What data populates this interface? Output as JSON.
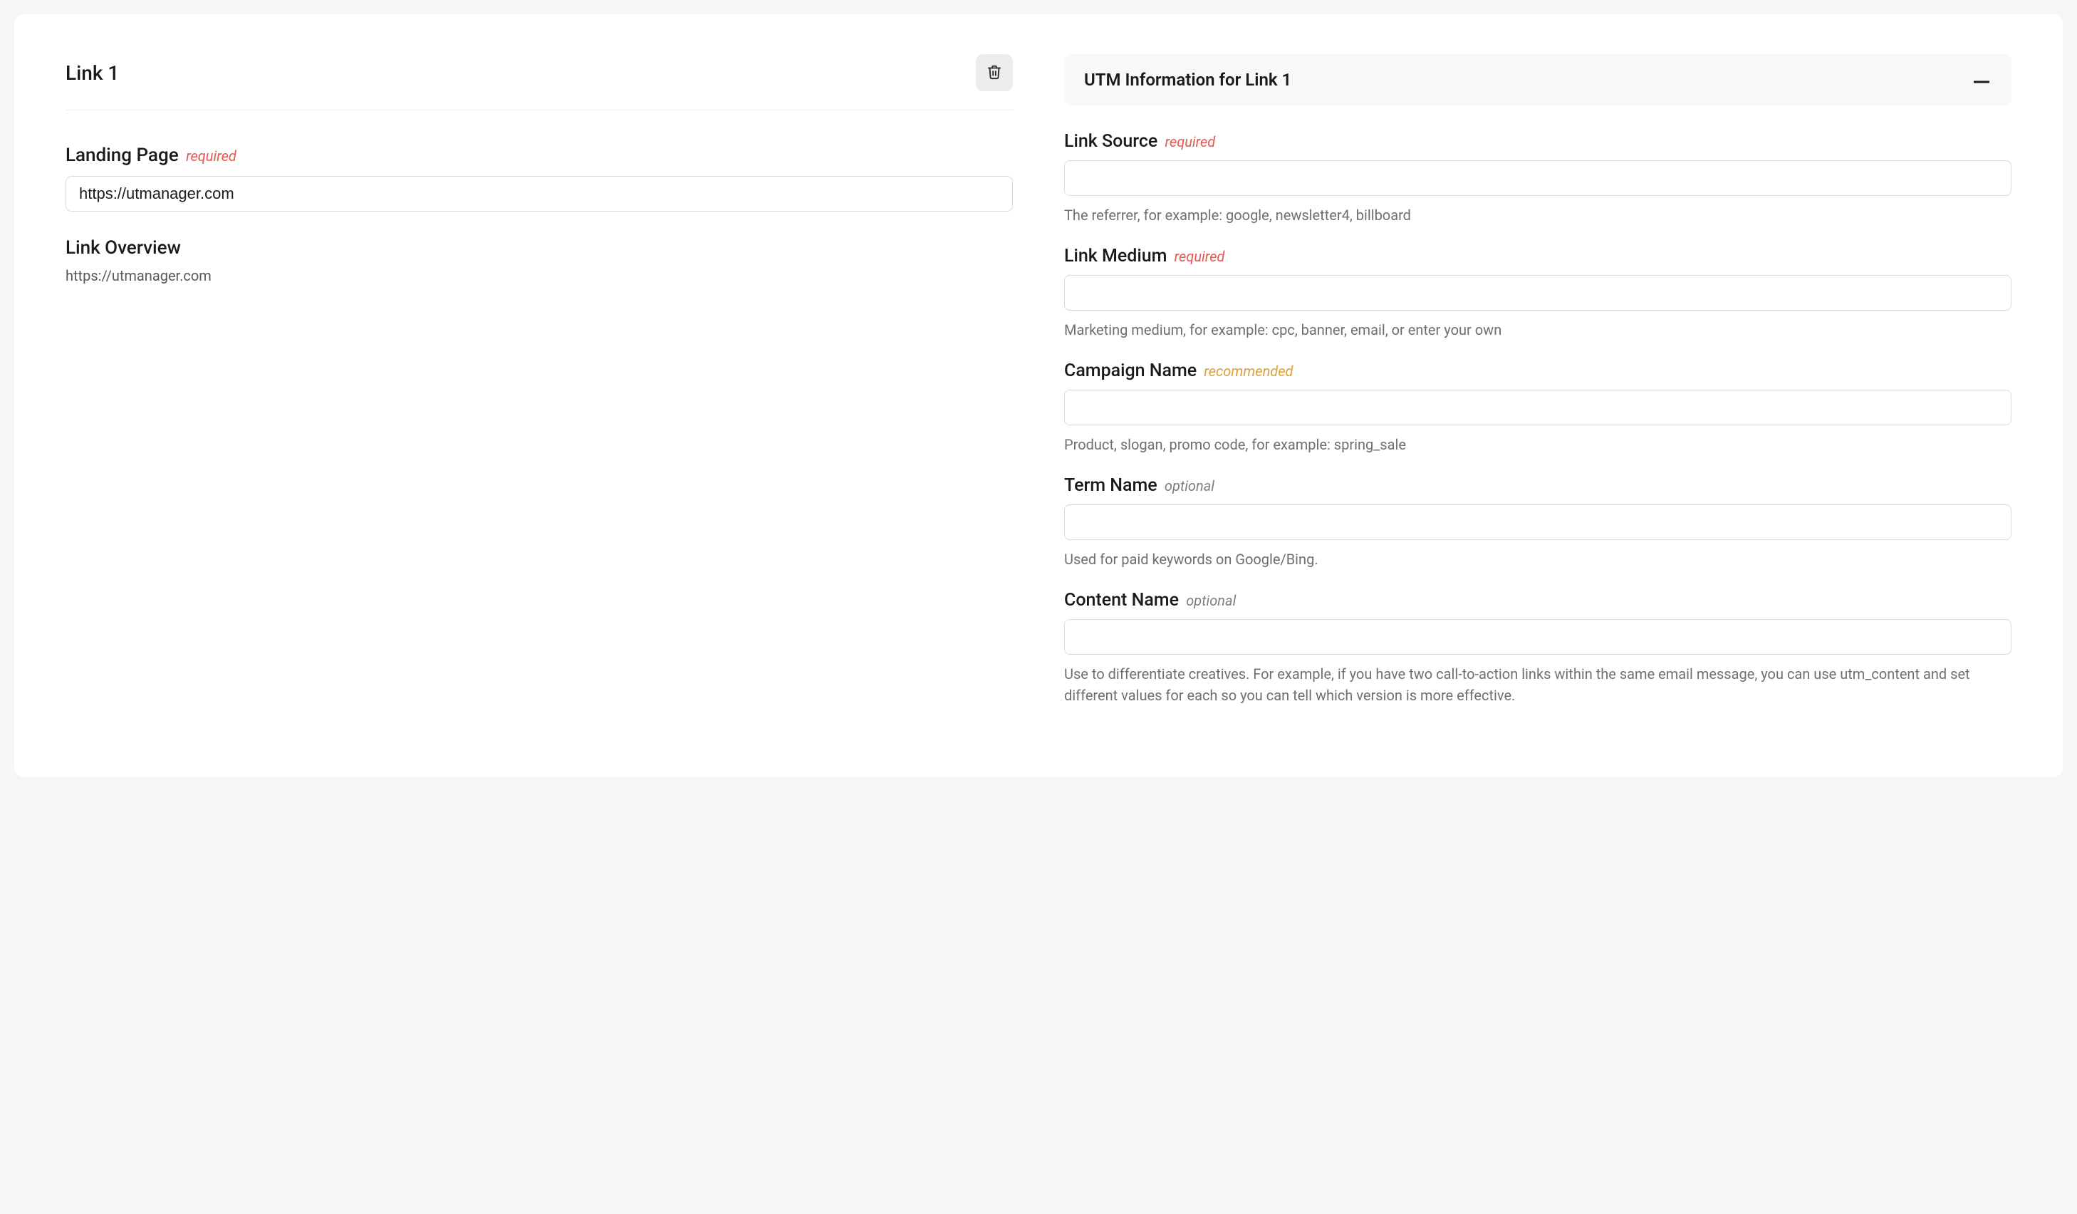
{
  "link": {
    "title": "Link 1",
    "landing_page": {
      "label": "Landing Page",
      "tag": "required",
      "value": "https://utmanager.com"
    },
    "overview": {
      "label": "Link Overview",
      "url": "https://utmanager.com"
    }
  },
  "utm": {
    "panel_title": "UTM Information for Link 1",
    "source": {
      "label": "Link Source",
      "tag": "required",
      "value": "",
      "help": "The referrer, for example: google, newsletter4, billboard"
    },
    "medium": {
      "label": "Link Medium",
      "tag": "required",
      "value": "",
      "help": "Marketing medium, for example: cpc, banner, email, or enter your own"
    },
    "campaign": {
      "label": "Campaign Name",
      "tag": "recommended",
      "value": "",
      "help": "Product, slogan, promo code, for example: spring_sale"
    },
    "term": {
      "label": "Term Name",
      "tag": "optional",
      "value": "",
      "help": "Used for paid keywords on Google/Bing."
    },
    "content": {
      "label": "Content Name",
      "tag": "optional",
      "value": "",
      "help": "Use to differentiate creatives. For example, if you have two call-to-action links within the same email message, you can use utm_content and set different values for each so you can tell which version is more effective."
    }
  }
}
